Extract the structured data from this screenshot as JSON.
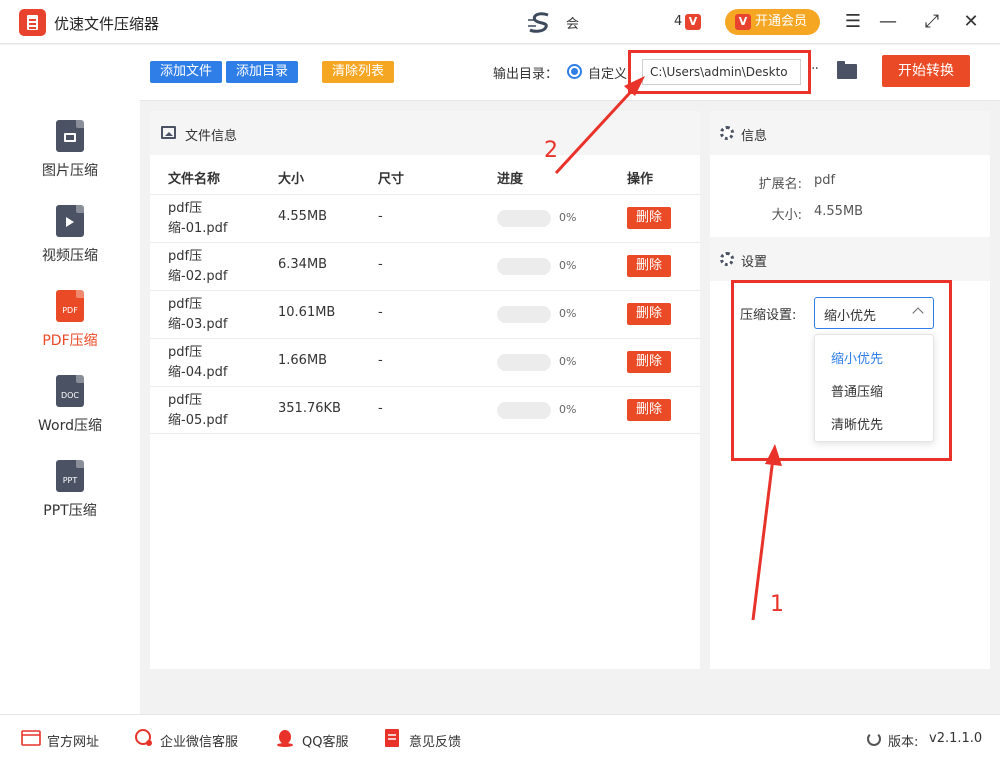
{
  "window": {
    "title": "优速文件压缩器",
    "user_name": "会",
    "vip_count": "4",
    "vip_small_icon": "V",
    "vip_button": "开通会员",
    "controls": {
      "menu": "☰",
      "minimize": "—",
      "maximize": "⤢",
      "close": "✕"
    }
  },
  "sidebar": {
    "items": [
      {
        "label": "图片压缩",
        "icon_text": "",
        "icon": "image-file-icon"
      },
      {
        "label": "视频压缩",
        "icon_text": "",
        "icon": "video-file-icon"
      },
      {
        "label": "PDF压缩",
        "icon_text": "PDF",
        "icon": "pdf-file-icon",
        "active": true
      },
      {
        "label": "Word压缩",
        "icon_text": "DOC",
        "icon": "doc-file-icon"
      },
      {
        "label": "PPT压缩",
        "icon_text": "PPT",
        "icon": "ppt-file-icon"
      }
    ]
  },
  "toolbar": {
    "add_file": "添加文件",
    "add_folder": "添加目录",
    "clear_list": "清除列表",
    "output_label": "输出目录：",
    "custom_option": "自定义",
    "output_path": "C:\\Users\\admin\\Deskto",
    "more": "··",
    "start": "开始转换"
  },
  "files": {
    "header": "文件信息",
    "columns": [
      "文件名称",
      "大小",
      "尺寸",
      "进度",
      "操作"
    ],
    "rows": [
      {
        "name": "pdf压缩-01.pdf",
        "size": "4.55MB",
        "dim": "-",
        "progress": 0,
        "progress_text": "0%",
        "action": "删除"
      },
      {
        "name": "pdf压缩-02.pdf",
        "size": "6.34MB",
        "dim": "-",
        "progress": 0,
        "progress_text": "0%",
        "action": "删除"
      },
      {
        "name": "pdf压缩-03.pdf",
        "size": "10.61MB",
        "dim": "-",
        "progress": 0,
        "progress_text": "0%",
        "action": "删除"
      },
      {
        "name": "pdf压缩-04.pdf",
        "size": "1.66MB",
        "dim": "-",
        "progress": 0,
        "progress_text": "0%",
        "action": "删除"
      },
      {
        "name": "pdf压缩-05.pdf",
        "size": "351.76KB",
        "dim": "-",
        "progress": 0,
        "progress_text": "0%",
        "action": "删除"
      }
    ]
  },
  "info": {
    "header": "信息",
    "ext_label": "扩展名:",
    "ext_value": "pdf",
    "size_label": "大小:",
    "size_value": "4.55MB"
  },
  "settings": {
    "header": "设置",
    "compress_label": "压缩设置:",
    "selected": "缩小优先",
    "options": [
      "缩小优先",
      "普通压缩",
      "清晰优先"
    ]
  },
  "annotations": {
    "num1": "1",
    "num2": "2",
    "color": "#e8322a"
  },
  "footer": {
    "website": "官方网址",
    "wechat": "企业微信客服",
    "qq": "QQ客服",
    "feedback": "意见反馈",
    "version_label": "版本:",
    "version": "v2.1.1.0"
  },
  "colors": {
    "accent": "#ea4a25",
    "primary_blue": "#2f7ee8",
    "clear_orange": "#f5a623",
    "vip_orange": "#f5a623"
  }
}
